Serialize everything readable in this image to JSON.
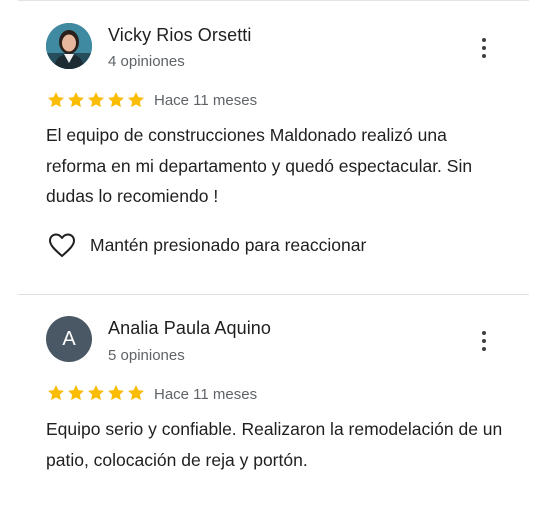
{
  "colors": {
    "star": "#fbbc04",
    "secondary_text": "#5f6368",
    "primary_text": "#1f1f1f",
    "avatar_letter_bg": "#4a5866"
  },
  "reviews": [
    {
      "name": "Vicky Rios Orsetti",
      "count": "4 opiniones",
      "rating": 5,
      "time": "Hace 11 meses",
      "text": "El equipo de construcciones Maldonado realizó una reforma en mi departamento y quedó espectacular. Sin dudas lo recomiendo !",
      "react_label": "Mantén presionado para reaccionar",
      "avatar_icon": "user-photo-icon"
    },
    {
      "name": "Analia Paula Aquino",
      "count": "5 opiniones",
      "rating": 5,
      "time": "Hace 11 meses",
      "text": "Equipo serio y confiable. Realizaron la remodelación de un patio, colocación de reja y portón.",
      "avatar_letter": "A"
    }
  ],
  "icons": {
    "menu": "more-vert-icon",
    "star": "star-icon",
    "heart": "heart-outline-icon"
  }
}
